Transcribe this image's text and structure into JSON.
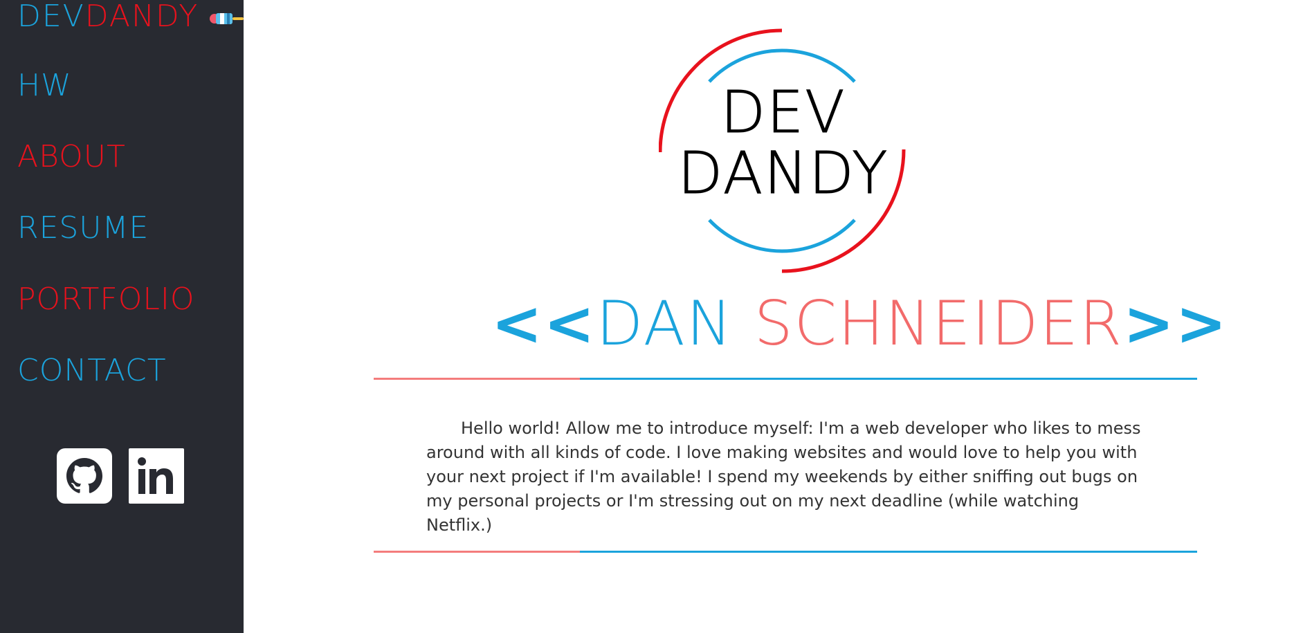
{
  "sidebar": {
    "brand": {
      "part1": "DEV",
      "part2": "DANDY"
    },
    "nav": [
      {
        "label": "HW",
        "color": "#1ba3dc"
      },
      {
        "label": "ABOUT",
        "color": "#e8121d"
      },
      {
        "label": "RESUME",
        "color": "#1ba3dc"
      },
      {
        "label": "PORTFOLIO",
        "color": "#e8121d"
      },
      {
        "label": "CONTACT",
        "color": "#1ba3dc"
      }
    ],
    "social": [
      {
        "icon": "github-icon"
      },
      {
        "icon": "linkedin-icon"
      }
    ]
  },
  "main": {
    "logo": {
      "line1": "DEV",
      "line2": "DANDY"
    },
    "name": {
      "open_quote": "<<",
      "first": "DAN",
      "last": "SCHNEIDER",
      "close_quote": ">>"
    },
    "intro": "Hello world! Allow me to introduce myself: I'm a web developer who likes to mess around with all kinds of code. I love making websites and would love to help you with your next project if I'm available! I spend my weekends by either sniffing out bugs on my personal projects or I'm stressing out on my next deadline (while watching Netflix.)"
  },
  "colors": {
    "sidebar_bg": "#282a31",
    "accent_blue": "#1ba3dc",
    "accent_red": "#e8121d",
    "accent_salmon": "#f26b6b"
  }
}
